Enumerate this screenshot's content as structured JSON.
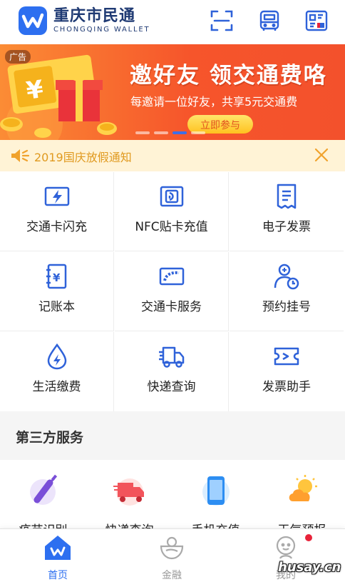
{
  "header": {
    "app_name": "重庆市民通",
    "app_subtitle": "CHONGQING WALLET",
    "icons": [
      "scan-icon",
      "bus-card-icon",
      "payment-code-icon"
    ]
  },
  "banner": {
    "ad_label": "广告",
    "title": "邀好友 领交通费咯",
    "subtitle": "每邀请一位好友，共享5元交通费",
    "button": "立即参与",
    "slides": 4,
    "active_slide": 3
  },
  "notice": {
    "text": "2019国庆放假通知",
    "color": "#e09a20",
    "background": "#fff3d6"
  },
  "services": [
    {
      "label": "交通卡闪充",
      "icon": "flash-card-icon"
    },
    {
      "label": "NFC贴卡充值",
      "icon": "nfc-card-icon"
    },
    {
      "label": "电子发票",
      "icon": "e-invoice-icon"
    },
    {
      "label": "记账本",
      "icon": "ledger-icon"
    },
    {
      "label": "交通卡服务",
      "icon": "transit-card-icon"
    },
    {
      "label": "预约挂号",
      "icon": "appointment-icon"
    },
    {
      "label": "生活缴费",
      "icon": "utility-drop-icon"
    },
    {
      "label": "快递查询",
      "icon": "delivery-truck-icon"
    },
    {
      "label": "发票助手",
      "icon": "invoice-ticket-icon"
    }
  ],
  "third_party": {
    "title": "第三方服务",
    "items": [
      {
        "label": "疫苗识别",
        "icon": "vaccine-icon"
      },
      {
        "label": "快递查询",
        "icon": "express-truck-icon"
      },
      {
        "label": "手机充值",
        "icon": "phone-topup-icon"
      },
      {
        "label": "天气预报",
        "icon": "weather-icon"
      }
    ]
  },
  "tabbar": {
    "tabs": [
      {
        "label": "首页",
        "icon": "home-icon",
        "active": true
      },
      {
        "label": "金融",
        "icon": "finance-icon",
        "active": false
      },
      {
        "label": "我的",
        "icon": "profile-icon",
        "active": false
      }
    ]
  },
  "watermark": "husay.cn",
  "colors": {
    "accent": "#2d6ff0",
    "icon_blue": "#2f62d9",
    "banner_orange": "#f6552b"
  }
}
